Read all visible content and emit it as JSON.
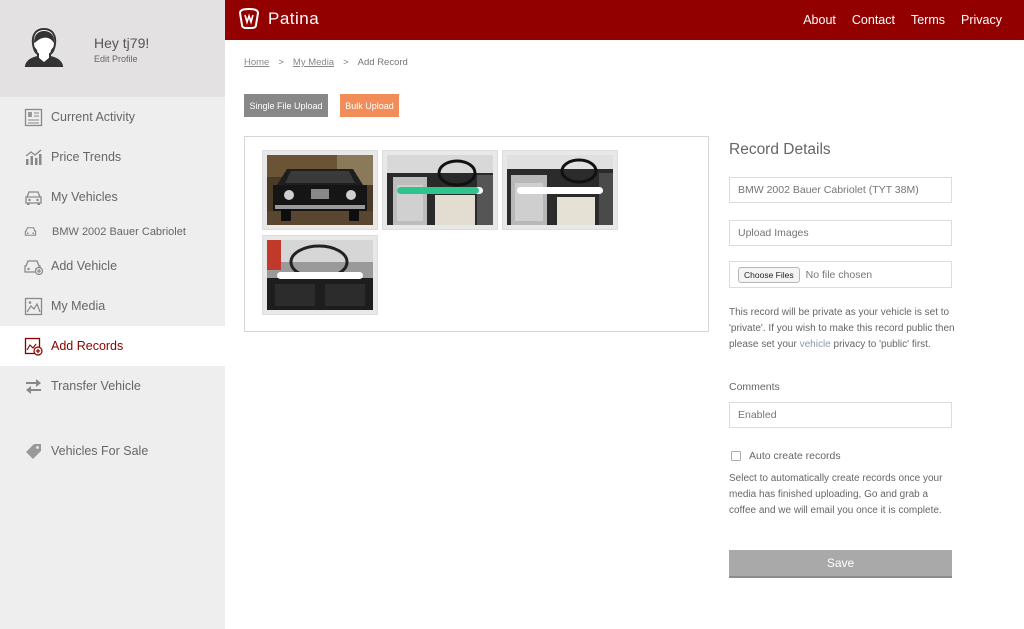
{
  "profile": {
    "greeting": "Hey tj79!",
    "edit_label": "Edit Profile"
  },
  "sidebar": {
    "items": [
      {
        "label": "Current Activity",
        "icon": "activity-icon"
      },
      {
        "label": "Price Trends",
        "icon": "chart-icon"
      },
      {
        "label": "My Vehicles",
        "icon": "car-icon"
      },
      {
        "label": "BMW 2002 Bauer Cabriolet",
        "icon": "car-small-icon"
      },
      {
        "label": "Add Vehicle",
        "icon": "add-car-icon"
      },
      {
        "label": "My Media",
        "icon": "image-icon"
      },
      {
        "label": "Add Records",
        "icon": "add-record-icon",
        "active": true
      },
      {
        "label": "Transfer Vehicle",
        "icon": "transfer-icon"
      },
      {
        "label": "Vehicles For Sale",
        "icon": "tag-icon"
      }
    ]
  },
  "header": {
    "brand": "Patina",
    "nav": [
      "About",
      "Contact",
      "Terms",
      "Privacy"
    ],
    "brand_color": "#930000"
  },
  "breadcrumb": {
    "home": "Home",
    "sep": ">",
    "media": "My Media",
    "current": "Add Record"
  },
  "upload": {
    "single_label": "Single File Upload",
    "bulk_label": "Bulk Upload",
    "bulk_color": "#f28c58"
  },
  "media": {
    "thumbnails": [
      {
        "name": "car-front-photo",
        "progress": null
      },
      {
        "name": "interior-photo-1",
        "progress": 0.95,
        "progress_color": "#2fc38e"
      },
      {
        "name": "interior-photo-2",
        "progress": 0
      },
      {
        "name": "interior-photo-3",
        "progress": 0
      }
    ]
  },
  "details": {
    "title": "Record Details",
    "vehicle_placeholder": "BMW 2002 Bauer Cabriolet (TYT 38M)",
    "upload_placeholder": "Upload Images",
    "choose_files": "Choose Files",
    "no_file": "No file chosen",
    "notice_before": "This record will be private as your vehicle is set to 'private'. If you wish to make this record public then please set your ",
    "notice_link": "vehicle",
    "notice_after": " privacy to 'public' first.",
    "comments_label": "Comments",
    "comments_placeholder": "Enabled",
    "auto_label": "Auto create records",
    "auto_help": "Select to automatically create records once your media has finished uploading, Go and grab a coffee and we will email you once it is complete.",
    "save_label": "Save"
  }
}
